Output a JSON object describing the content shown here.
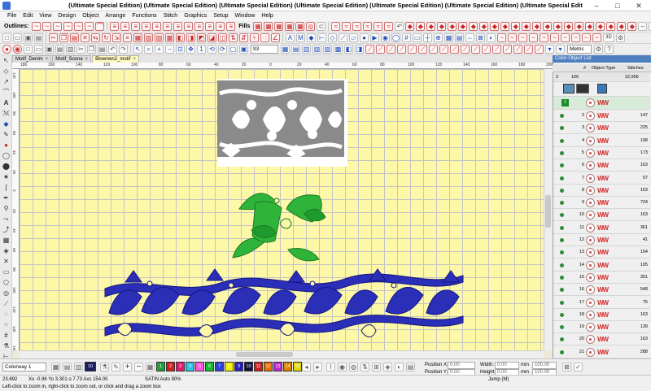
{
  "window": {
    "title": "(Ultimate Special Edition) (Ultimate Special Edition) (Ultimate Special Edition) (Ultimate Special Edition) (Ultimate Special Edition) (Ultimate Special Edition) (Ultimate Special Edit"
  },
  "menu": [
    "File",
    "Edit",
    "View",
    "Design",
    "Object",
    "Arrange",
    "Functions",
    "Stitch",
    "Graphics",
    "Setup",
    "Window",
    "Help"
  ],
  "toolbar": {
    "outlines_label": "Outlines:",
    "fills_label": "Fills",
    "view_3d": "3D",
    "zoom_value": "93",
    "units_value": "Metric"
  },
  "tabs": [
    {
      "label": "Motif_Denim"
    },
    {
      "label": "Motif_Sosna"
    },
    {
      "label": "Bloemen2_motif"
    }
  ],
  "rulers": {
    "top": [
      "180",
      "160",
      "140",
      "120",
      "100",
      "80",
      "60",
      "40",
      "20",
      "0",
      "20",
      "40",
      "60",
      "80",
      "100",
      "120",
      "140",
      "160",
      "180",
      "200"
    ],
    "left": [
      "120",
      "100",
      "80",
      "60",
      "40",
      "20",
      "0",
      "20",
      "40",
      "60",
      "80",
      "100",
      "120",
      "140",
      "160"
    ]
  },
  "panel": {
    "title": "Color-Object List",
    "headers": {
      "hash": "#",
      "object_type": "Object Type",
      "stitches": "Stitches"
    },
    "summary": {
      "num": "3",
      "count": "106",
      "stitches": "22,955"
    },
    "group": {
      "num": "1"
    },
    "rows": [
      {
        "num": "2",
        "st": "147"
      },
      {
        "num": "3",
        "st": "225"
      },
      {
        "num": "4",
        "st": "198"
      },
      {
        "num": "5",
        "st": "173"
      },
      {
        "num": "6",
        "st": "163"
      },
      {
        "num": "7",
        "st": "57"
      },
      {
        "num": "8",
        "st": "153"
      },
      {
        "num": "9",
        "st": "724"
      },
      {
        "num": "10",
        "st": "163"
      },
      {
        "num": "11",
        "st": "361"
      },
      {
        "num": "12",
        "st": "41"
      },
      {
        "num": "13",
        "st": "154"
      },
      {
        "num": "14",
        "st": "105"
      },
      {
        "num": "15",
        "st": "351"
      },
      {
        "num": "16",
        "st": "548"
      },
      {
        "num": "17",
        "st": "75"
      },
      {
        "num": "18",
        "st": "163"
      },
      {
        "num": "19",
        "st": "139"
      },
      {
        "num": "20",
        "st": "163"
      },
      {
        "num": "21",
        "st": "288"
      }
    ]
  },
  "bottom": {
    "colorway": "Colorway 1",
    "current_color": "10",
    "swatches": [
      {
        "label": "1",
        "color": "#1f9e3a"
      },
      {
        "label": "2",
        "color": "#d11e1e"
      },
      {
        "label": "3",
        "color": "#e01a6c"
      },
      {
        "label": "4",
        "color": "#2ec4e8"
      },
      {
        "label": "5",
        "color": "#ff55dd"
      },
      {
        "label": "6",
        "color": "#16b82d"
      },
      {
        "label": "7",
        "color": "#2f3fd4"
      },
      {
        "label": "8",
        "color": "#f0f000"
      },
      {
        "label": "9",
        "color": "#2a1db8"
      },
      {
        "label": "10",
        "color": "#101040"
      },
      {
        "label": "11",
        "color": "#c81f1f"
      },
      {
        "label": "12",
        "color": "#e86a00"
      },
      {
        "label": "13",
        "color": "#ba2ad0"
      },
      {
        "label": "14",
        "color": "#d88200"
      },
      {
        "label": "15",
        "color": "#e0d800"
      }
    ],
    "position_x_label": "Position X:",
    "position_y_label": "Position Y:",
    "width_label": "Width:",
    "height_label": "Height:",
    "position_x": "0.00",
    "position_y": "0.00",
    "width": "0.00",
    "height": "0.00",
    "width_unit": "mm",
    "height_unit": "mm",
    "width_pct": "100.00",
    "height_pct": "100.00"
  },
  "status": {
    "count": "23.692",
    "coords": "Xo -0.96 Yo  3.301 o   7.73 Axs 154.00",
    "stitch_type": "SATIN Auto 90%",
    "mode": "Jump (M)",
    "hint": "Left-click to zoom in, right-click to zoom out, or click and drag a zoom box"
  }
}
